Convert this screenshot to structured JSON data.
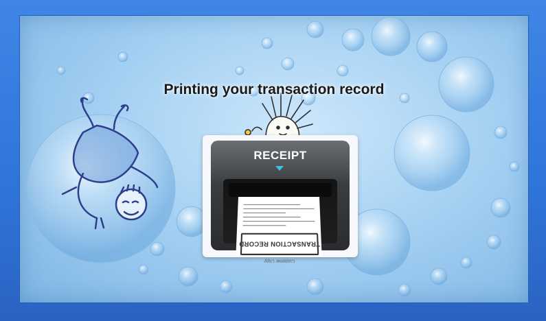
{
  "screen": {
    "title": "Printing your transaction record"
  },
  "printer": {
    "label": "RECEIPT",
    "arrow_icon": "triangle-down-icon",
    "paper_heading": "TRANSACTION RECORD",
    "paper_subheading": "Customer Copy"
  },
  "illustration": {
    "left_character": "doodle-creature-in-bubble",
    "top_character": "doodle-hedgehog-peeking"
  },
  "colors": {
    "frame": "#2f74d8",
    "screen_bg": "#a7d2f3",
    "accent_arrow": "#39c3e8",
    "printer_body": "#3a3d41"
  }
}
